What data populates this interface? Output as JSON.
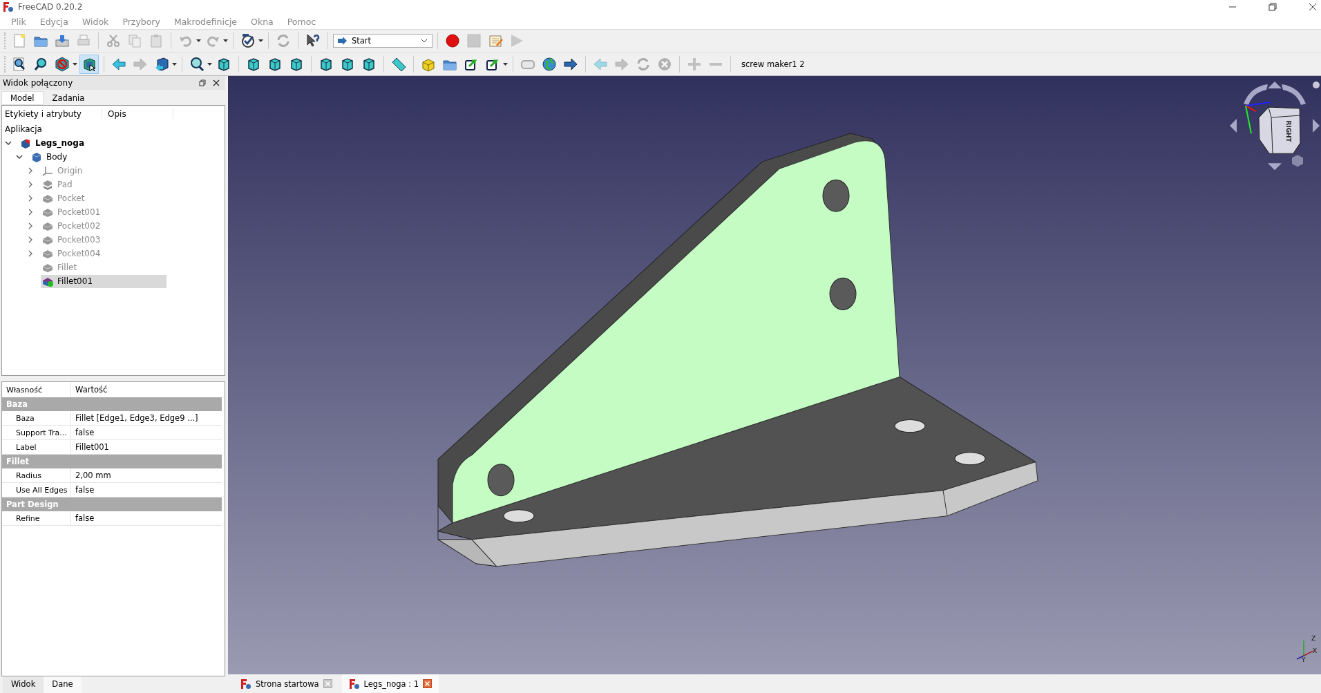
{
  "window": {
    "title": "FreeCAD 0.20.2"
  },
  "menu": [
    "Plik",
    "Edycja",
    "Widok",
    "Przybory",
    "Makrodefinicje",
    "Okna",
    "Pomoc"
  ],
  "toolbar": {
    "workbench": "Start",
    "macro_label": "screw maker1 2"
  },
  "combo_view": {
    "title": "Widok połączony",
    "tabs": [
      {
        "label": "Model",
        "selected": true
      },
      {
        "label": "Zadania",
        "selected": false
      }
    ],
    "tree": {
      "columns": [
        "Etykiety i atrybuty",
        "Opis"
      ],
      "root_label": "Aplikacja",
      "items": [
        {
          "label": "Legs_noga",
          "kind": "document",
          "expanded": true,
          "visible": true,
          "selected": false,
          "children": [
            {
              "label": "Body",
              "kind": "body",
              "expanded": true,
              "visible": true,
              "selected": false,
              "children": [
                {
                  "label": "Origin",
                  "kind": "origin",
                  "expanded": false,
                  "visible": false,
                  "selected": false
                },
                {
                  "label": "Pad",
                  "kind": "pad",
                  "expanded": false,
                  "visible": false,
                  "selected": false
                },
                {
                  "label": "Pocket",
                  "kind": "feature",
                  "expanded": false,
                  "visible": false,
                  "selected": false
                },
                {
                  "label": "Pocket001",
                  "kind": "feature",
                  "expanded": false,
                  "visible": false,
                  "selected": false
                },
                {
                  "label": "Pocket002",
                  "kind": "feature",
                  "expanded": false,
                  "visible": false,
                  "selected": false
                },
                {
                  "label": "Pocket003",
                  "kind": "feature",
                  "expanded": false,
                  "visible": false,
                  "selected": false
                },
                {
                  "label": "Pocket004",
                  "kind": "feature",
                  "expanded": false,
                  "visible": false,
                  "selected": false
                },
                {
                  "label": "Fillet",
                  "kind": "feature",
                  "visible": false,
                  "selected": false
                },
                {
                  "label": "Fillet001",
                  "kind": "tip",
                  "visible": true,
                  "selected": true
                }
              ]
            }
          ]
        }
      ]
    },
    "properties": {
      "columns": [
        "Własność",
        "Wartość"
      ],
      "groups": [
        {
          "name": "Baza",
          "rows": [
            {
              "name": "Baza",
              "value": "Fillet [Edge1, Edge3, Edge9 ...]"
            },
            {
              "name": "Support Tra...",
              "value": "false"
            },
            {
              "name": "Label",
              "value": "Fillet001"
            }
          ]
        },
        {
          "name": "Fillet",
          "rows": [
            {
              "name": "Radius",
              "value": "2,00 mm"
            },
            {
              "name": "Use All Edges",
              "value": "false"
            }
          ]
        },
        {
          "name": "Part Design",
          "rows": [
            {
              "name": "Refine",
              "value": "false"
            }
          ]
        }
      ]
    },
    "bottom_tabs": [
      {
        "label": "Widok",
        "selected": false
      },
      {
        "label": "Dane",
        "selected": true
      }
    ]
  },
  "nav_cube": {
    "face_label": "RIGHT"
  },
  "axis_labels": [
    "Z",
    "Y",
    "X"
  ],
  "document_tabs": [
    {
      "label": "Strona startowa",
      "selected": false
    },
    {
      "label": "Legs_noga : 1",
      "selected": true
    }
  ]
}
